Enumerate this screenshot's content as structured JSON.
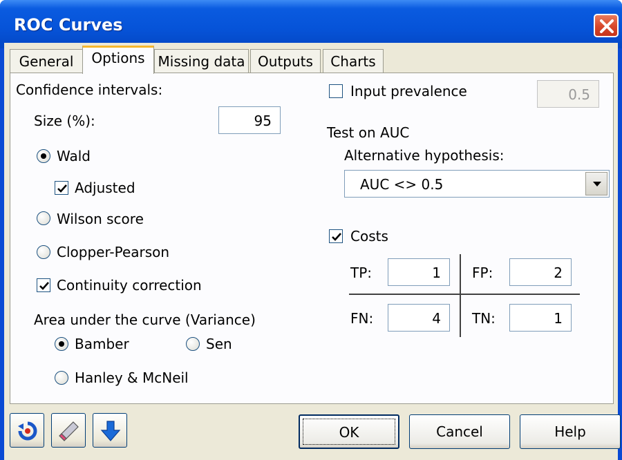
{
  "window": {
    "title": "ROC Curves",
    "close_label": "close"
  },
  "tabs": [
    "General",
    "Options",
    "Missing data",
    "Outputs",
    "Charts"
  ],
  "active_tab": "Options",
  "options": {
    "ci_label": "Confidence intervals:",
    "size_label": "Size (%):",
    "size_value": "95",
    "wald_label": "Wald",
    "wald_checked": true,
    "adjusted_label": "Adjusted",
    "adjusted_checked": true,
    "wilson_label": "Wilson score",
    "clopper_label": "Clopper-Pearson",
    "continuity_label": "Continuity correction",
    "continuity_checked": true,
    "auc_variance_label": "Area under the curve (Variance)",
    "bamber_label": "Bamber",
    "bamber_checked": true,
    "sen_label": "Sen",
    "hanley_label": "Hanley & McNeil",
    "input_prevalence_label": "Input prevalence",
    "input_prevalence_checked": false,
    "prevalence_value": "0.5",
    "test_auc_label": "Test on AUC",
    "alt_hypothesis_label": "Alternative hypothesis:",
    "alt_hypothesis_value": "AUC <> 0.5",
    "costs_label": "Costs",
    "costs_checked": true,
    "tp_label": "TP:",
    "tp_value": "1",
    "fp_label": "FP:",
    "fp_value": "2",
    "fn_label": "FN:",
    "fn_value": "4",
    "tn_label": "TN:",
    "tn_value": "1"
  },
  "buttons": {
    "ok": "OK",
    "cancel": "Cancel",
    "help": "Help"
  },
  "icons": {
    "reset": "reset-icon",
    "eraser": "eraser-icon",
    "down": "down-arrow-icon"
  },
  "colors": {
    "titlebar": "#0653d8",
    "close": "#d7472a",
    "tab_highlight": "#f5b72e",
    "face": "#ece9d8"
  }
}
